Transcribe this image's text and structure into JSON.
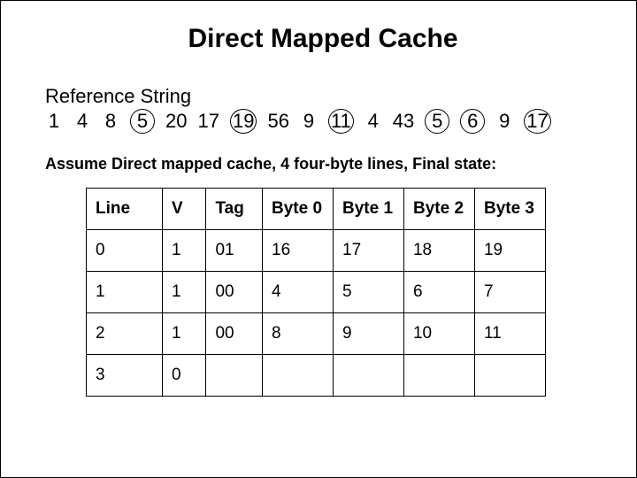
{
  "title": "Direct Mapped Cache",
  "ref_label": "Reference String",
  "ref": {
    "i0": {
      "v": "1",
      "c": false
    },
    "i1": {
      "v": "4",
      "c": false
    },
    "i2": {
      "v": "8",
      "c": false
    },
    "i3": {
      "v": "5",
      "c": true
    },
    "i4": {
      "v": "20",
      "c": false
    },
    "i5": {
      "v": "17",
      "c": false
    },
    "i6": {
      "v": "19",
      "c": true
    },
    "i7": {
      "v": "56",
      "c": false
    },
    "i8": {
      "v": "9",
      "c": false
    },
    "i9": {
      "v": "11",
      "c": true
    },
    "i10": {
      "v": "4",
      "c": false
    },
    "i11": {
      "v": "43",
      "c": false
    },
    "i12": {
      "v": "5",
      "c": true
    },
    "i13": {
      "v": "6",
      "c": true
    },
    "i14": {
      "v": "9",
      "c": false
    },
    "i15": {
      "v": "17",
      "c": true
    }
  },
  "assume": "Assume Direct mapped cache, 4 four-byte lines, Final state:",
  "headers": {
    "line": "Line",
    "v": "V",
    "tag": "Tag",
    "b0": "Byte 0",
    "b1": "Byte 1",
    "b2": "Byte 2",
    "b3": "Byte 3"
  },
  "rows": {
    "r0": {
      "line": "0",
      "v": "1",
      "tag": "01",
      "b0": "16",
      "b1": "17",
      "b2": "18",
      "b3": "19"
    },
    "r1": {
      "line": "1",
      "v": "1",
      "tag": "00",
      "b0": "4",
      "b1": "5",
      "b2": "6",
      "b3": "7"
    },
    "r2": {
      "line": "2",
      "v": "1",
      "tag": "00",
      "b0": "8",
      "b1": "9",
      "b2": "10",
      "b3": "11"
    },
    "r3": {
      "line": "3",
      "v": "0",
      "tag": "",
      "b0": "",
      "b1": "",
      "b2": "",
      "b3": ""
    }
  }
}
